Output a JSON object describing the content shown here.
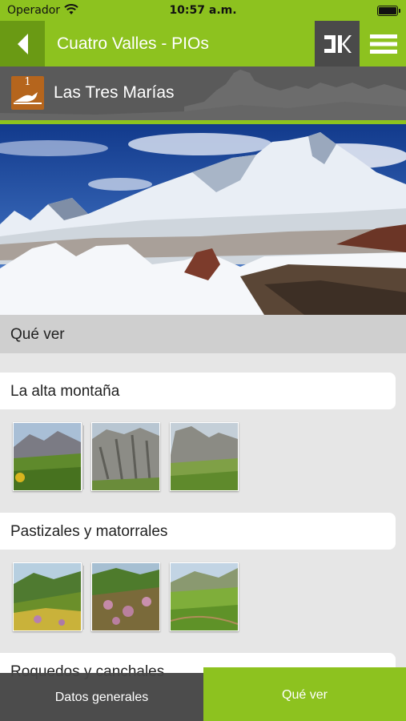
{
  "status_bar": {
    "carrier": "Operador",
    "time": "10:57 a.m."
  },
  "header": {
    "title": "Cuatro Valles - PIOs",
    "back_icon": "back-arrow-icon",
    "brand_icon": "cuatro-valles-logo-icon",
    "menu_icon": "hamburger-menu-icon"
  },
  "location": {
    "number": "1",
    "name": "Las Tres Marías",
    "badge_icon": "bird-icon"
  },
  "section": {
    "title": "Qué ver"
  },
  "categories": [
    {
      "title": "La alta montaña",
      "thumbnails": [
        "mountain-meadow",
        "rock-cliff",
        "rocky-peak-meadow"
      ]
    },
    {
      "title": "Pastizales y matorrales",
      "thumbnails": [
        "flowering-slope",
        "heather-field",
        "green-valley"
      ]
    },
    {
      "title": "Roquedos y canchales",
      "thumbnails": []
    }
  ],
  "tabs": [
    {
      "label": "Datos generales",
      "active": false
    },
    {
      "label": "Qué ver",
      "active": true
    }
  ],
  "colors": {
    "accent_green": "#8dc21f",
    "dark_gray": "#4a4a4a",
    "badge_brown": "#b5651d"
  }
}
